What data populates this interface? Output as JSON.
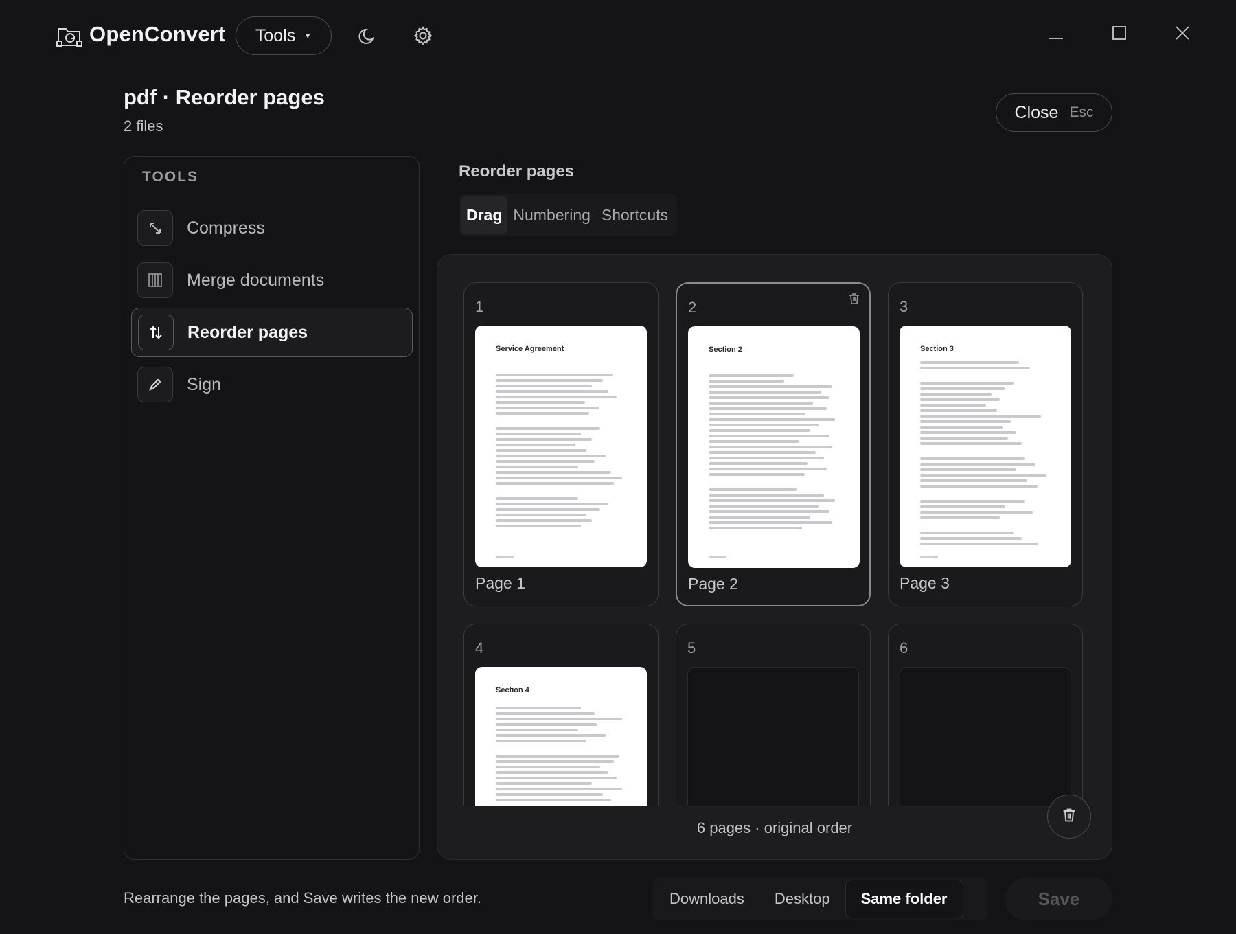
{
  "app": {
    "name": "OpenConvert",
    "logo_icon": "folder-refresh-icon",
    "tools_label": "Tools",
    "theme_icon": "moon-icon",
    "settings_icon": "gear-icon",
    "window_controls": [
      "minimize-icon",
      "maximize-icon",
      "close-icon"
    ]
  },
  "header": {
    "title": "pdf · Reorder pages",
    "subtitle": "2 files",
    "close_label": "Close",
    "close_shortcut": "Esc"
  },
  "sidebar": {
    "heading": "TOOLS",
    "items": [
      {
        "label": "Compress",
        "icon": "compress-arrow-icon",
        "active": false
      },
      {
        "label": "Merge documents",
        "icon": "merge-columns-icon",
        "active": false
      },
      {
        "label": "Reorder pages",
        "icon": "swap-vertical-icon",
        "active": true
      },
      {
        "label": "Sign",
        "icon": "pen-icon",
        "active": false
      }
    ]
  },
  "main": {
    "section_title": "Reorder pages",
    "tabs": [
      {
        "label": "Drag",
        "active": true
      },
      {
        "label": "Numbering",
        "active": false
      },
      {
        "label": "Shortcuts",
        "active": false
      }
    ],
    "pages": [
      {
        "number": "1",
        "label": "Page 1",
        "heading": "Service Agreement",
        "rendered": true,
        "selected": false
      },
      {
        "number": "2",
        "label": "Page 2",
        "heading": "Section 2",
        "rendered": true,
        "selected": true
      },
      {
        "number": "3",
        "label": "Page 3",
        "heading": "Section 3",
        "rendered": true,
        "selected": false
      },
      {
        "number": "4",
        "label": "",
        "heading": "Section 4",
        "rendered": true,
        "selected": false
      },
      {
        "number": "5",
        "label": "",
        "heading": "",
        "rendered": false,
        "selected": false
      },
      {
        "number": "6",
        "label": "",
        "heading": "",
        "rendered": false,
        "selected": false
      }
    ],
    "status": "6 pages · original order",
    "delete_icon": "trash-icon"
  },
  "footer": {
    "hint": "Rearrange the pages, and Save writes the new order.",
    "destinations": [
      {
        "label": "Downloads",
        "active": false
      },
      {
        "label": "Desktop",
        "active": false
      },
      {
        "label": "Same folder",
        "active": true
      }
    ],
    "save_label": "Save"
  },
  "colors": {
    "background": "#141416",
    "panel": "#1d1d20",
    "text": "#e8e8ea",
    "muted": "#9a9aa0",
    "save_disabled": "#55555a"
  }
}
